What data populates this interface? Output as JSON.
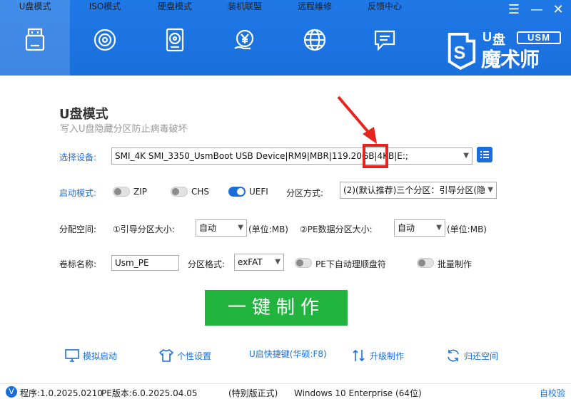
{
  "window": {
    "menu_glyph": "☰",
    "minimize_glyph": "—",
    "close_glyph": "✕"
  },
  "nav": [
    {
      "label": "U盘模式",
      "icon": "usb-icon",
      "active": true
    },
    {
      "label": "ISO模式",
      "icon": "disc-icon"
    },
    {
      "label": "硬盘模式",
      "icon": "harddisk-icon"
    },
    {
      "label": "装机联盟",
      "icon": "yen-icon"
    },
    {
      "label": "远程维修",
      "icon": "globe-icon"
    },
    {
      "label": "反馈中心",
      "icon": "feedback-icon"
    }
  ],
  "logo": {
    "u": "U",
    "pan": "盘",
    "badge": "USM",
    "brand": "魔术师"
  },
  "page": {
    "title": "U盘模式",
    "subtitle": "写入U盘隐藏分区防止病毒破坏"
  },
  "device": {
    "label": "选择设备:",
    "value": "SMI_4K SMI_3350_UsmBoot USB Device|RM9|MBR|119.20GB|4KB|E:;"
  },
  "boot": {
    "label": "启动模式:",
    "zip": "ZIP",
    "chs": "CHS",
    "uefi": "UEFI",
    "partition_label": "分区方式:",
    "partition_value": "(2)(默认推荐)三个分区：引导分区(隐"
  },
  "alloc": {
    "label": "分配空间:",
    "boot_size_label": "①引导分区大小:",
    "boot_size_value": "自动",
    "boot_unit": "(单位:MB)",
    "pe_size_label": "②PE数据分区大小:",
    "pe_size_value": "自动",
    "pe_unit": "(单位:MB)"
  },
  "volume": {
    "label": "卷标名称:",
    "value": "Usm_PE",
    "format_label": "分区格式:",
    "format_value": "exFAT",
    "auto_letter": "PE下自动理顺盘符",
    "batch": "批量制作"
  },
  "action": {
    "make": "一键制作"
  },
  "tools": {
    "simulate": "模拟启动",
    "personal": "个性设置",
    "hotkey": "U启快捷键(华硕:F8)",
    "upgrade": "升级制作",
    "restore": "归还空间"
  },
  "status": {
    "version_badge": "V",
    "program": "程序:1.0.2025.0210",
    "pe": "PE版本:6.0.2025.04.05",
    "edition": "(特别版正式)",
    "os": "Windows 10 Enterprise (64位)",
    "self_check": "自校验"
  },
  "colors": {
    "accent": "#1a6fdc",
    "make_button": "#22b43f",
    "highlight": "#e8231d"
  }
}
